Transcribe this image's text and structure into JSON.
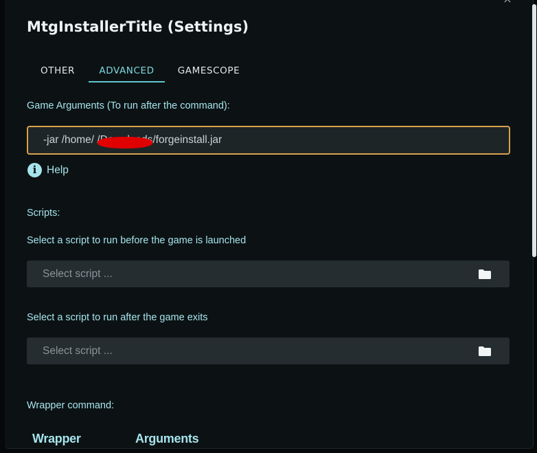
{
  "window": {
    "title": "MtgInstallerTitle (Settings)",
    "close_glyph": "×"
  },
  "tabs": [
    {
      "label": "OTHER",
      "active": false
    },
    {
      "label": "ADVANCED",
      "active": true
    },
    {
      "label": "GAMESCOPE",
      "active": false
    }
  ],
  "game_arguments": {
    "label": "Game Arguments (To run after the command):",
    "value": "-jar /home/        /Downloads/forgeinstall.jar"
  },
  "help": {
    "icon": "info-icon",
    "glyph": "i",
    "label": "Help"
  },
  "scripts": {
    "section_label": "Scripts:",
    "before": {
      "label": "Select a script to run before the game is launched",
      "placeholder": "Select script ...",
      "icon": "folder-icon"
    },
    "after": {
      "label": "Select a script to run after the game exits",
      "placeholder": "Select script ...",
      "icon": "folder-icon"
    }
  },
  "wrapper": {
    "label": "Wrapper command:",
    "columns": [
      "Wrapper",
      "Arguments"
    ]
  },
  "colors": {
    "accent": "#5fc8cf",
    "label_text": "#a6e4ec",
    "focus_border": "#d9a24b",
    "background": "#0c1214",
    "field_background": "#252d30"
  }
}
